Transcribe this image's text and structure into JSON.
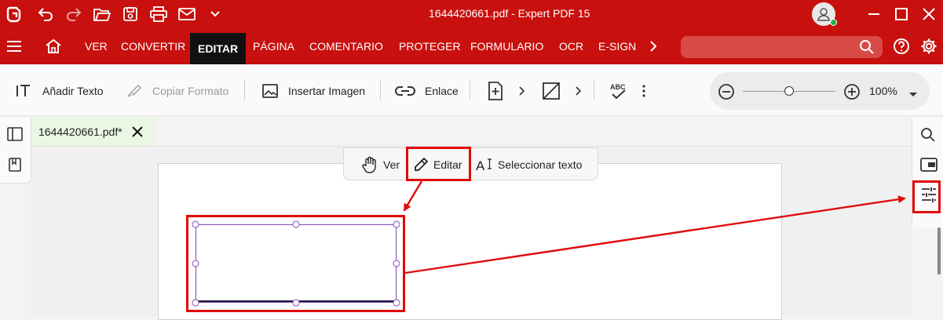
{
  "window": {
    "title": "1644420661.pdf  -  Expert PDF 15"
  },
  "titlebar": {
    "icons": [
      "app-logo-icon",
      "undo-icon",
      "redo-icon",
      "open-folder-icon",
      "save-icon",
      "print-icon",
      "mail-icon",
      "chevron-down-icon",
      "user-avatar-icon",
      "minimize-icon",
      "maximize-icon",
      "close-icon"
    ]
  },
  "menu": {
    "items": [
      "VER",
      "CONVERTIR",
      "EDITAR",
      "PÁGINA",
      "COMENTARIO",
      "PROTEGER",
      "FORMULARIO",
      "OCR",
      "E-SIGN"
    ],
    "active": "EDITAR"
  },
  "toolbar": {
    "add_text": "Añadir Texto",
    "copy_format": "Copiar Formato",
    "insert_image": "Insertar Imagen",
    "link": "Enlace",
    "zoom_value": "100%"
  },
  "tab": {
    "filename": "1644420661.pdf*"
  },
  "mode_bar": {
    "ver": "Ver",
    "editar": "Editar",
    "select_text": "Seleccionar texto"
  },
  "colors": {
    "brand_red": "#c8100e",
    "annotation_red": "#e00b0b",
    "selection_purple": "#7b4bb0",
    "tab_green": "#e9f7e4"
  },
  "zoom": {
    "slider_fraction": 0.5
  }
}
